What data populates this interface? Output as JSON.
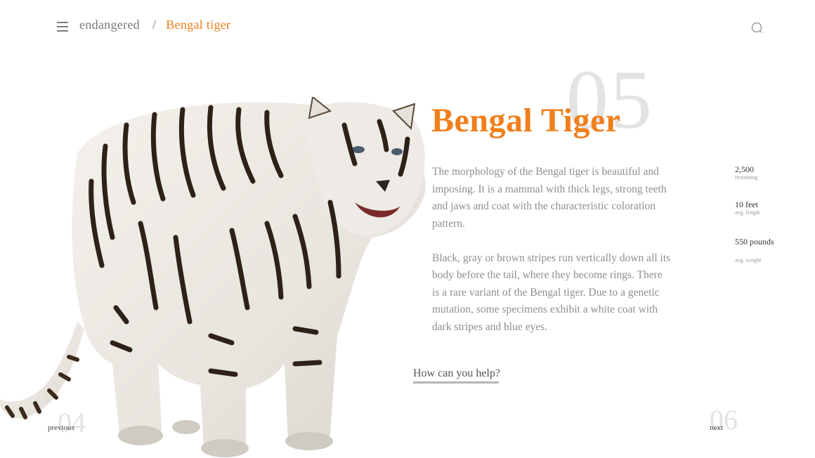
{
  "header": {
    "menu_icon": "hamburger-menu-icon",
    "breadcrumb": {
      "parent": "endangered",
      "separator": "/",
      "current": "Bengal tiger"
    },
    "search_icon": "search-icon"
  },
  "animal": {
    "number": "05",
    "name": "Bengal Tiger",
    "description": [
      "The morphology of the Bengal tiger is beautiful and imposing. It is a mammal with thick legs, strong teeth and jaws and coat with the characteristic coloration pattern.",
      "Black, gray or brown stripes run vertically down all its body before the tail, where they become rings. There is a rare variant of the Bengal tiger. Due to a genetic mutation, some specimens exhibit a white coat with dark stripes and blue eyes."
    ],
    "cta": "How can you help?",
    "image_alt": "white Bengal tiger"
  },
  "stats": [
    {
      "value": "2,500",
      "label": "remaining"
    },
    {
      "value": "10 feet",
      "label": "avg. length"
    },
    {
      "value": "550 pounds",
      "label": "avg. weight"
    }
  ],
  "navigation": {
    "prev": {
      "number": "04",
      "label": "previous"
    },
    "next": {
      "number": "06",
      "label": "next"
    }
  },
  "colors": {
    "accent": "#f07f1c",
    "muted_number": "#e3e3e3",
    "body_text": "#8f8f8f"
  }
}
